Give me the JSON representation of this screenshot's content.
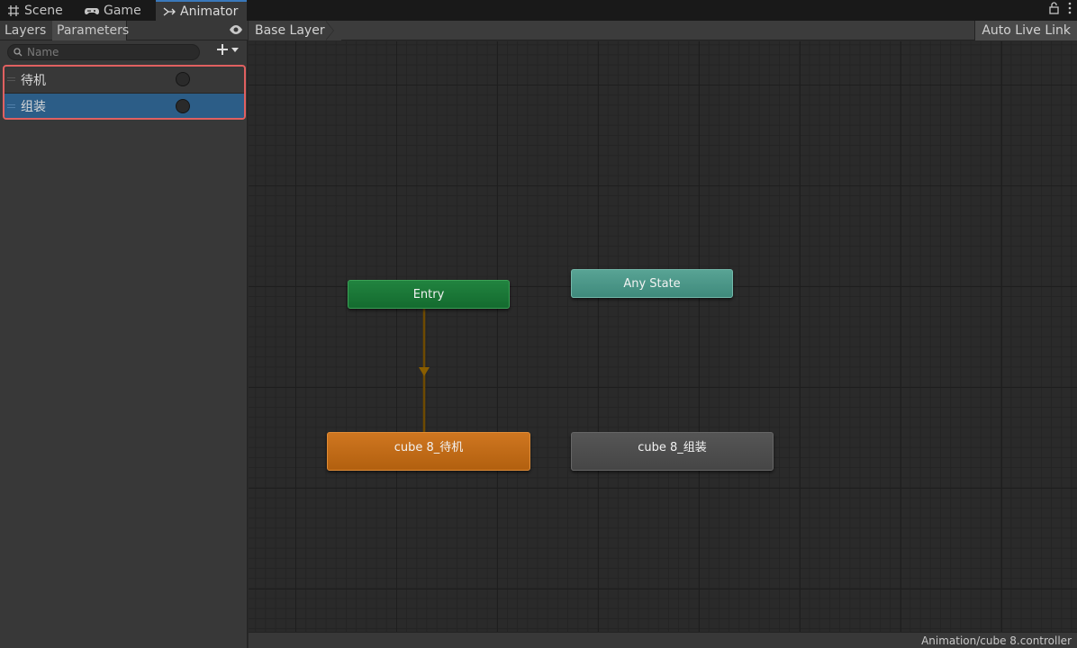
{
  "tabs": [
    {
      "label": "Scene",
      "icon": "grid-icon"
    },
    {
      "label": "Game",
      "icon": "gamepad-icon"
    },
    {
      "label": "Animator",
      "icon": "animator-icon"
    }
  ],
  "window_actions": {
    "lock_icon": "lock-icon",
    "menu_icon": "kebab-menu-icon"
  },
  "left_panel": {
    "tabs": [
      "Layers",
      "Parameters"
    ],
    "active_tab": "Parameters",
    "search": {
      "placeholder": "Name",
      "value": ""
    },
    "parameters": [
      {
        "name": "待机",
        "type": "trigger",
        "selected": false
      },
      {
        "name": "组装",
        "type": "trigger",
        "selected": true
      }
    ]
  },
  "graph": {
    "breadcrumb": "Base Layer",
    "auto_live_link": "Auto Live Link",
    "nodes": {
      "entry": "Entry",
      "any_state": "Any State",
      "default_state": "cube 8_待机",
      "state": "cube 8_组装"
    }
  },
  "status_bar": {
    "path": "Animation/cube 8.controller"
  },
  "colors": {
    "entry": "#1a7a37",
    "any_state": "#4f998a",
    "default_state": "#c06b17",
    "state": "#4e4e4e",
    "selection": "#2c5d87",
    "highlight_border": "#e06060",
    "transition": "#7a5200"
  }
}
